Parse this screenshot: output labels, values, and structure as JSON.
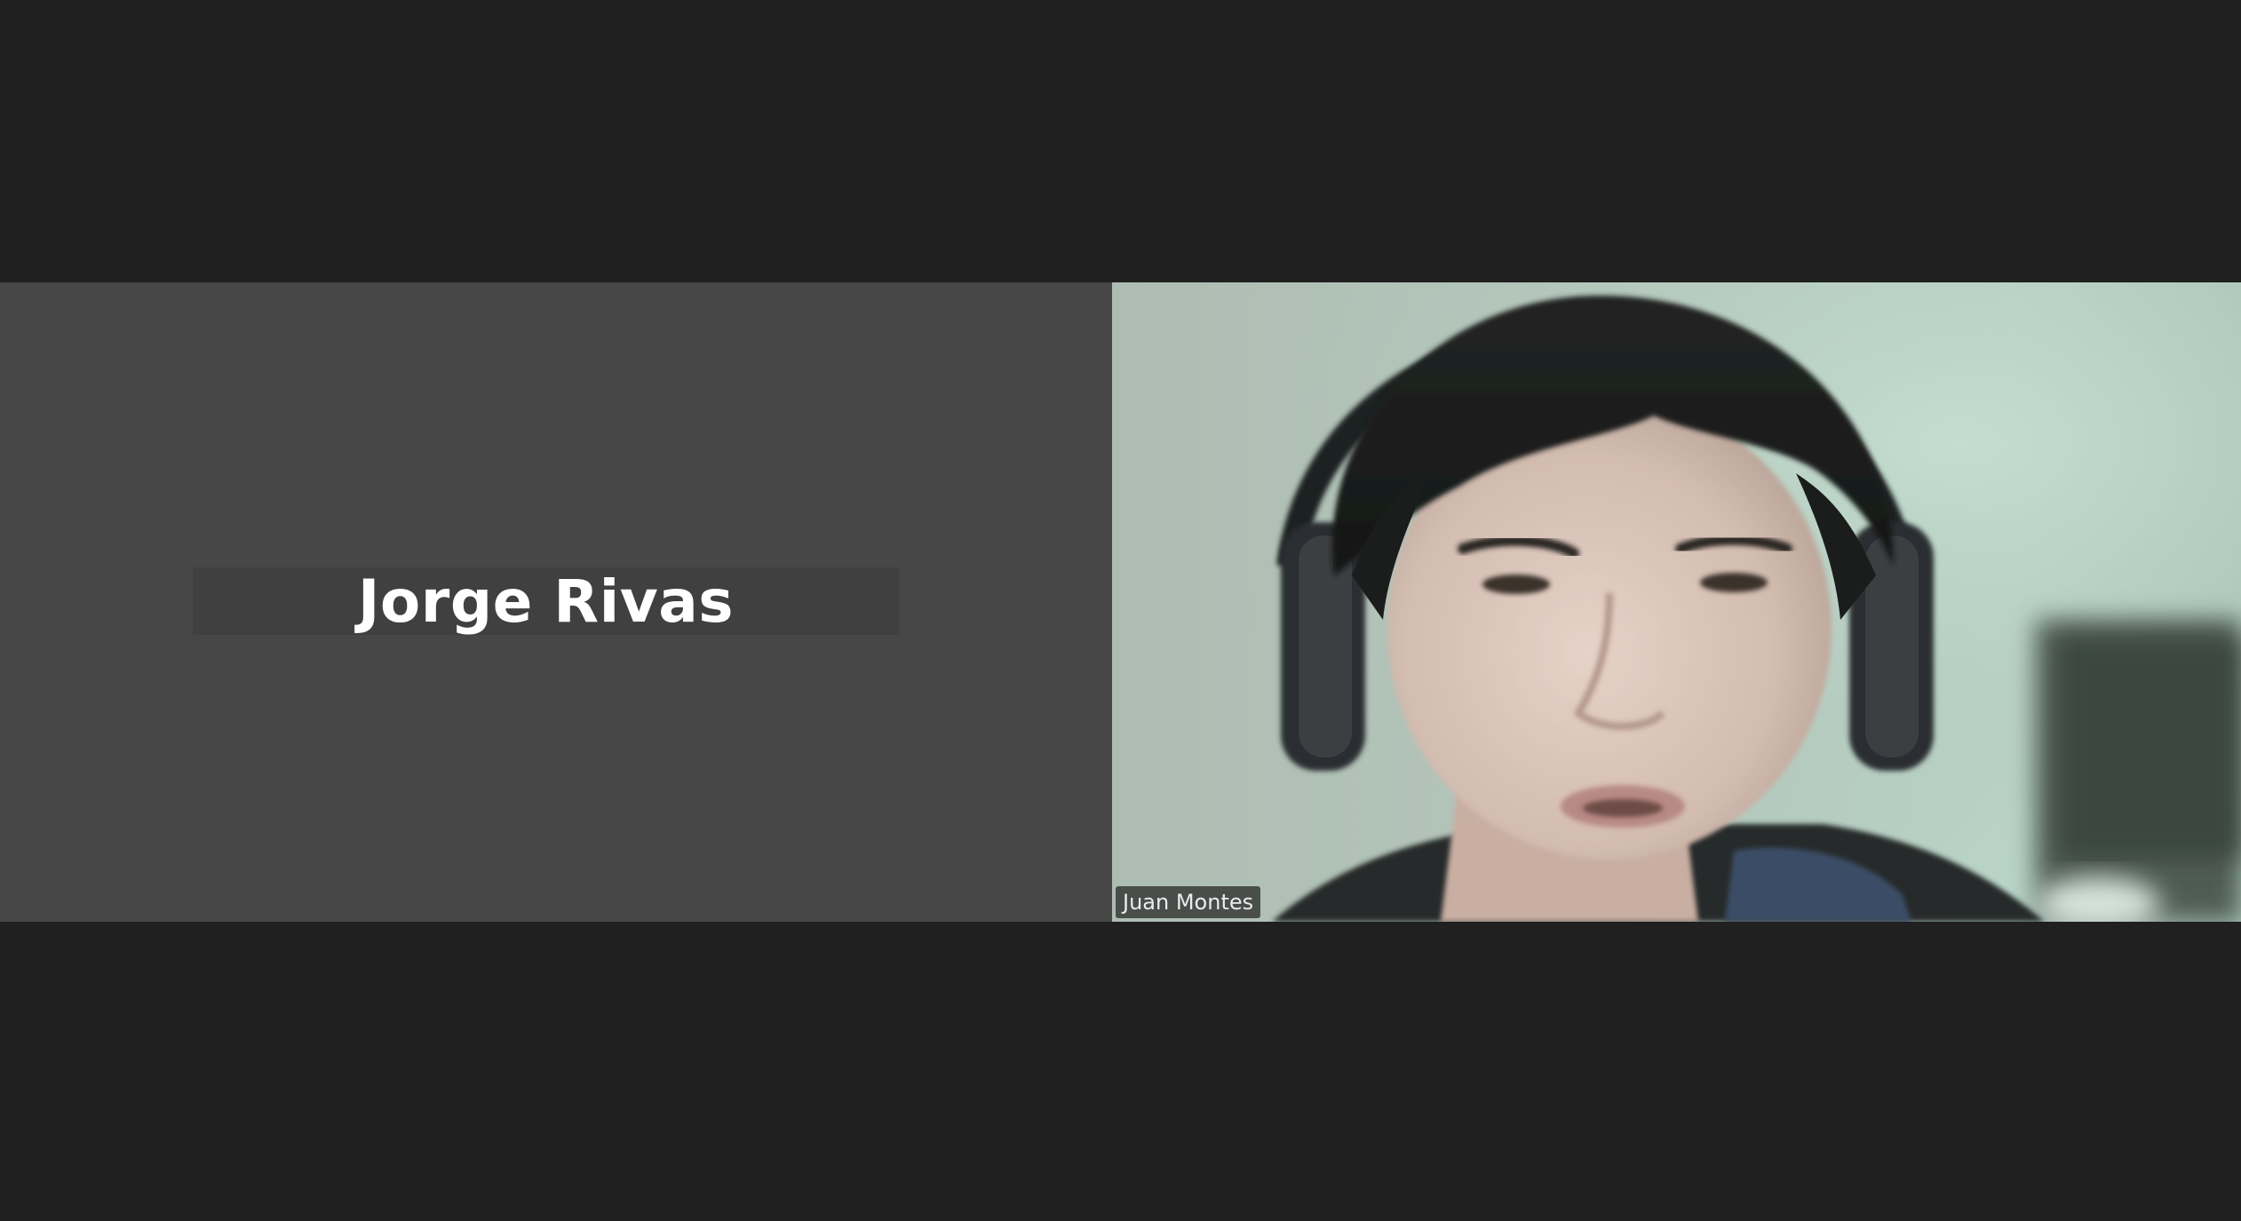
{
  "meeting": {
    "tiles": [
      {
        "participant_name": "Jorge Rivas",
        "video_on": false
      },
      {
        "participant_name": "Juan Montes",
        "video_on": true
      }
    ]
  },
  "colors": {
    "background": "#202020",
    "avatar_tile": "#474747",
    "name_text": "#ffffff"
  }
}
